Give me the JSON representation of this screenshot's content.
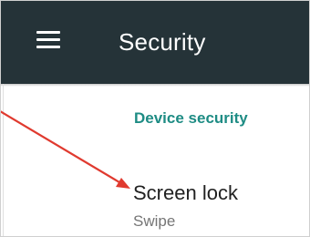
{
  "app_bar": {
    "title": "Security",
    "menu_icon": "hamburger-menu-icon",
    "background_color": "#253338"
  },
  "section": {
    "header": "Device security",
    "header_color": "#1e8c84"
  },
  "settings": [
    {
      "title": "Screen lock",
      "summary": "Swipe"
    }
  ],
  "annotation": {
    "type": "arrow",
    "color": "#e03a2f",
    "points_to": "Screen lock"
  }
}
